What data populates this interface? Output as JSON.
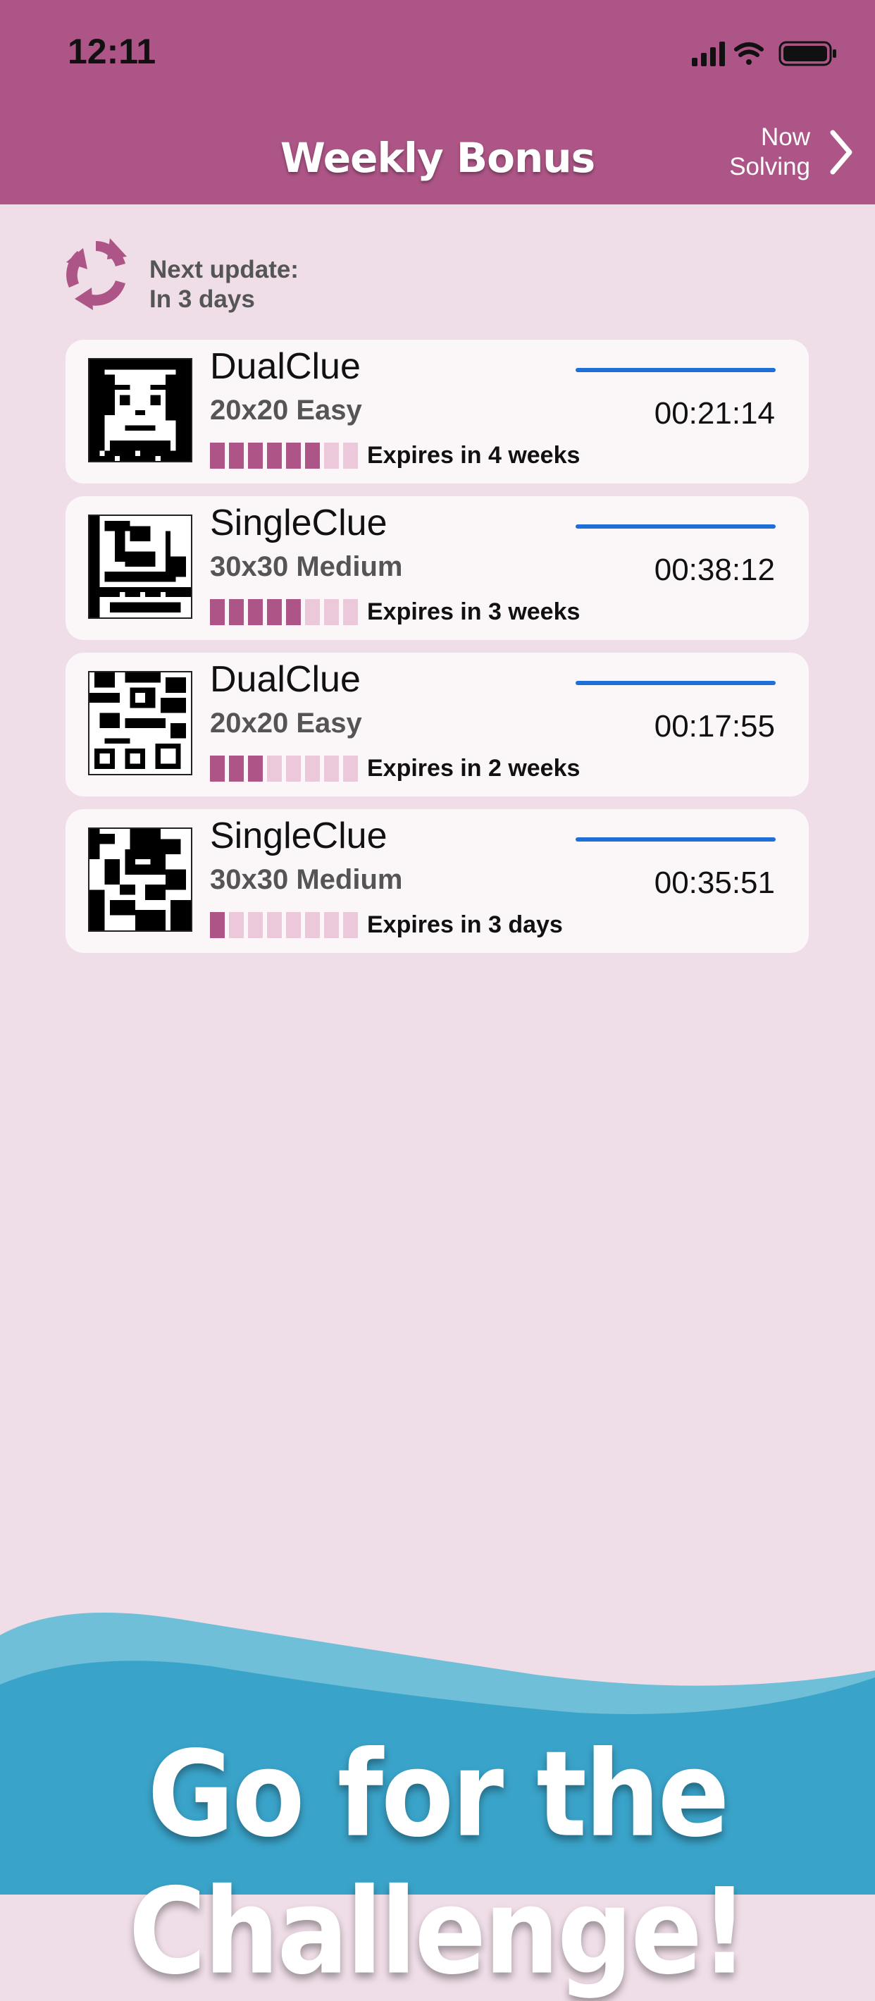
{
  "status": {
    "time": "12:11"
  },
  "nav": {
    "title": "Weekly Bonus",
    "now_solving": "Now Solving"
  },
  "update": {
    "line1": "Next update:",
    "line2": "In 3 days"
  },
  "colors": {
    "accent": "#ad5586",
    "progress": "#1f6fd8",
    "segment_off": "#ecc9da",
    "banner": "#3aa3c9"
  },
  "puzzles": [
    {
      "type": "DualClue",
      "size": "20x20 Easy",
      "time": "00:21:14",
      "expires": "Expires in 4 weeks",
      "segments_filled": 6,
      "segments_total": 8
    },
    {
      "type": "SingleClue",
      "size": "30x30 Medium",
      "time": "00:38:12",
      "expires": "Expires in 3 weeks",
      "segments_filled": 5,
      "segments_total": 8
    },
    {
      "type": "DualClue",
      "size": "20x20 Easy",
      "time": "00:17:55",
      "expires": "Expires in 2 weeks",
      "segments_filled": 3,
      "segments_total": 8
    },
    {
      "type": "SingleClue",
      "size": "30x30 Medium",
      "time": "00:35:51",
      "expires": "Expires in 3 days",
      "segments_filled": 1,
      "segments_total": 8
    }
  ],
  "banner": {
    "text": "Go for the Challenge!"
  }
}
